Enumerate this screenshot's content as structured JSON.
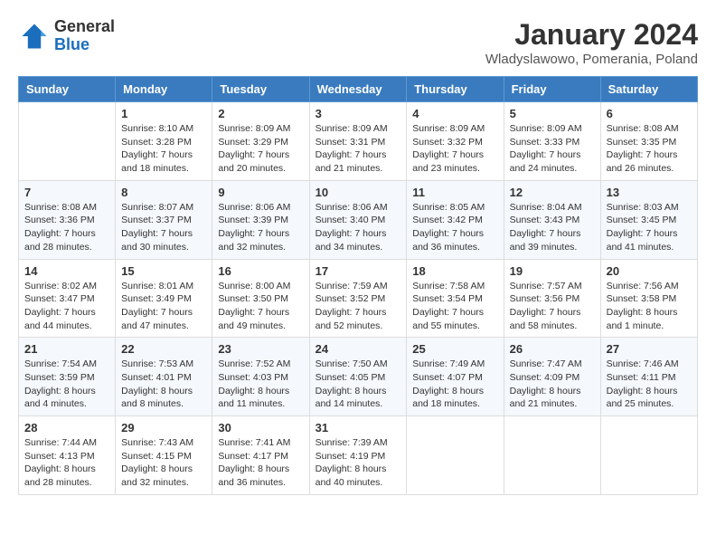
{
  "header": {
    "logo_general": "General",
    "logo_blue": "Blue",
    "month_title": "January 2024",
    "location": "Wladyslawowo, Pomerania, Poland"
  },
  "days_of_week": [
    "Sunday",
    "Monday",
    "Tuesday",
    "Wednesday",
    "Thursday",
    "Friday",
    "Saturday"
  ],
  "weeks": [
    [
      {
        "day": "",
        "info": ""
      },
      {
        "day": "1",
        "info": "Sunrise: 8:10 AM\nSunset: 3:28 PM\nDaylight: 7 hours\nand 18 minutes."
      },
      {
        "day": "2",
        "info": "Sunrise: 8:09 AM\nSunset: 3:29 PM\nDaylight: 7 hours\nand 20 minutes."
      },
      {
        "day": "3",
        "info": "Sunrise: 8:09 AM\nSunset: 3:31 PM\nDaylight: 7 hours\nand 21 minutes."
      },
      {
        "day": "4",
        "info": "Sunrise: 8:09 AM\nSunset: 3:32 PM\nDaylight: 7 hours\nand 23 minutes."
      },
      {
        "day": "5",
        "info": "Sunrise: 8:09 AM\nSunset: 3:33 PM\nDaylight: 7 hours\nand 24 minutes."
      },
      {
        "day": "6",
        "info": "Sunrise: 8:08 AM\nSunset: 3:35 PM\nDaylight: 7 hours\nand 26 minutes."
      }
    ],
    [
      {
        "day": "7",
        "info": "Sunrise: 8:08 AM\nSunset: 3:36 PM\nDaylight: 7 hours\nand 28 minutes."
      },
      {
        "day": "8",
        "info": "Sunrise: 8:07 AM\nSunset: 3:37 PM\nDaylight: 7 hours\nand 30 minutes."
      },
      {
        "day": "9",
        "info": "Sunrise: 8:06 AM\nSunset: 3:39 PM\nDaylight: 7 hours\nand 32 minutes."
      },
      {
        "day": "10",
        "info": "Sunrise: 8:06 AM\nSunset: 3:40 PM\nDaylight: 7 hours\nand 34 minutes."
      },
      {
        "day": "11",
        "info": "Sunrise: 8:05 AM\nSunset: 3:42 PM\nDaylight: 7 hours\nand 36 minutes."
      },
      {
        "day": "12",
        "info": "Sunrise: 8:04 AM\nSunset: 3:43 PM\nDaylight: 7 hours\nand 39 minutes."
      },
      {
        "day": "13",
        "info": "Sunrise: 8:03 AM\nSunset: 3:45 PM\nDaylight: 7 hours\nand 41 minutes."
      }
    ],
    [
      {
        "day": "14",
        "info": "Sunrise: 8:02 AM\nSunset: 3:47 PM\nDaylight: 7 hours\nand 44 minutes."
      },
      {
        "day": "15",
        "info": "Sunrise: 8:01 AM\nSunset: 3:49 PM\nDaylight: 7 hours\nand 47 minutes."
      },
      {
        "day": "16",
        "info": "Sunrise: 8:00 AM\nSunset: 3:50 PM\nDaylight: 7 hours\nand 49 minutes."
      },
      {
        "day": "17",
        "info": "Sunrise: 7:59 AM\nSunset: 3:52 PM\nDaylight: 7 hours\nand 52 minutes."
      },
      {
        "day": "18",
        "info": "Sunrise: 7:58 AM\nSunset: 3:54 PM\nDaylight: 7 hours\nand 55 minutes."
      },
      {
        "day": "19",
        "info": "Sunrise: 7:57 AM\nSunset: 3:56 PM\nDaylight: 7 hours\nand 58 minutes."
      },
      {
        "day": "20",
        "info": "Sunrise: 7:56 AM\nSunset: 3:58 PM\nDaylight: 8 hours\nand 1 minute."
      }
    ],
    [
      {
        "day": "21",
        "info": "Sunrise: 7:54 AM\nSunset: 3:59 PM\nDaylight: 8 hours\nand 4 minutes."
      },
      {
        "day": "22",
        "info": "Sunrise: 7:53 AM\nSunset: 4:01 PM\nDaylight: 8 hours\nand 8 minutes."
      },
      {
        "day": "23",
        "info": "Sunrise: 7:52 AM\nSunset: 4:03 PM\nDaylight: 8 hours\nand 11 minutes."
      },
      {
        "day": "24",
        "info": "Sunrise: 7:50 AM\nSunset: 4:05 PM\nDaylight: 8 hours\nand 14 minutes."
      },
      {
        "day": "25",
        "info": "Sunrise: 7:49 AM\nSunset: 4:07 PM\nDaylight: 8 hours\nand 18 minutes."
      },
      {
        "day": "26",
        "info": "Sunrise: 7:47 AM\nSunset: 4:09 PM\nDaylight: 8 hours\nand 21 minutes."
      },
      {
        "day": "27",
        "info": "Sunrise: 7:46 AM\nSunset: 4:11 PM\nDaylight: 8 hours\nand 25 minutes."
      }
    ],
    [
      {
        "day": "28",
        "info": "Sunrise: 7:44 AM\nSunset: 4:13 PM\nDaylight: 8 hours\nand 28 minutes."
      },
      {
        "day": "29",
        "info": "Sunrise: 7:43 AM\nSunset: 4:15 PM\nDaylight: 8 hours\nand 32 minutes."
      },
      {
        "day": "30",
        "info": "Sunrise: 7:41 AM\nSunset: 4:17 PM\nDaylight: 8 hours\nand 36 minutes."
      },
      {
        "day": "31",
        "info": "Sunrise: 7:39 AM\nSunset: 4:19 PM\nDaylight: 8 hours\nand 40 minutes."
      },
      {
        "day": "",
        "info": ""
      },
      {
        "day": "",
        "info": ""
      },
      {
        "day": "",
        "info": ""
      }
    ]
  ]
}
